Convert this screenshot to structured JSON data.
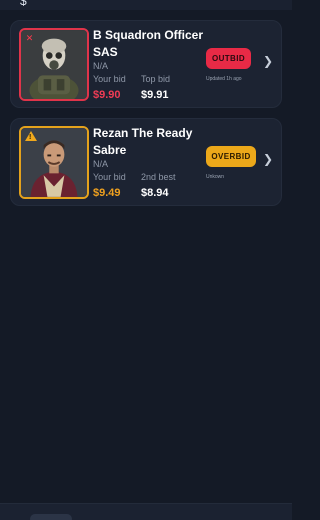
{
  "header": {
    "partial_glyph": "$"
  },
  "listings": [
    {
      "name": "B Squadron Officer SAS",
      "condition": "N/A",
      "status_icon": "x-icon",
      "your_bid_label": "Your bid",
      "your_bid": "$9.90",
      "compare_label": "Top bid",
      "compare_value": "$9.91",
      "status": "OUTBID",
      "note": "Updated 1h ago",
      "status_color": "#e82a46"
    },
    {
      "name": "Rezan The Ready Sabre",
      "condition": "N/A",
      "status_icon": "warning-icon",
      "your_bid_label": "Your bid",
      "your_bid": "$9.49",
      "compare_label": "2nd best",
      "compare_value": "$8.94",
      "status": "OVERBID",
      "note": "Unkown",
      "status_color": "#eca81a"
    }
  ]
}
